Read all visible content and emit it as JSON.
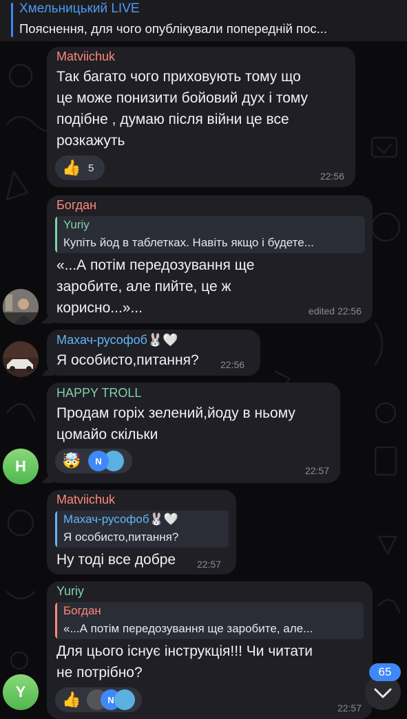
{
  "pinned": {
    "title": "Хмельницький LIVE",
    "text": "Пояснення, для чого опублікували попередній пос..."
  },
  "messages": [
    {
      "sender": "Matviichuk",
      "sender_color": "#ff8a78",
      "lines": [
        "Так багато чого приховують тому що",
        "це може понизити бойовий дух і тому",
        "подібне , думаю після війни це все",
        "розкажуть"
      ],
      "reaction": {
        "emoji": "👍",
        "count": "5"
      },
      "time": "22:56"
    },
    {
      "sender": "Богдан",
      "sender_color": "#ff8a78",
      "reply": {
        "name": "Yuriy",
        "name_color": "#7fd3a8",
        "text": "Купіть йод в таблетках. Навіть якщо і будете..."
      },
      "lines": [
        "«...А потім передозування ще",
        "заробите, але пийте, це ж",
        "корисно...»..."
      ],
      "time": "edited 22:56"
    },
    {
      "sender": "Махач-русофоб🐰🤍",
      "sender_color": "#62b7f5",
      "lines": [
        "Я особисто,питання?"
      ],
      "time": "22:56"
    },
    {
      "sender": "HAPPY TROLL",
      "sender_color": "#7fd3a8",
      "lines": [
        "Продам горіх зелений,йоду в ньому",
        "цомайо скільки"
      ],
      "reaction": {
        "emoji": "🤯"
      },
      "time": "22:57",
      "avatar_letter": "H"
    },
    {
      "sender": "Matviichuk",
      "sender_color": "#ff8a78",
      "reply": {
        "name": "Махач-русофоб🐰🤍",
        "name_color": "#62b7f5",
        "text": "Я особисто,питання?"
      },
      "lines": [
        "Ну тоді все добре"
      ],
      "time": "22:57"
    },
    {
      "sender": "Yuriy",
      "sender_color": "#7fd3a8",
      "reply": {
        "name": "Богдан",
        "name_color": "#ff8a78",
        "text": "«...А потім передозування ще заробите, але..."
      },
      "lines": [
        "Для цього існує інструкція!!! Чи читати",
        "не потрібно?"
      ],
      "reaction": {
        "emoji": "👍"
      },
      "time": "22:57",
      "avatar_letter": "Y"
    }
  ],
  "reactor_letter": "N",
  "unread_count": "65",
  "colors": {
    "accent": "#3e88f7",
    "bubble": "#1f1f25",
    "background": "#0b0b0d"
  }
}
